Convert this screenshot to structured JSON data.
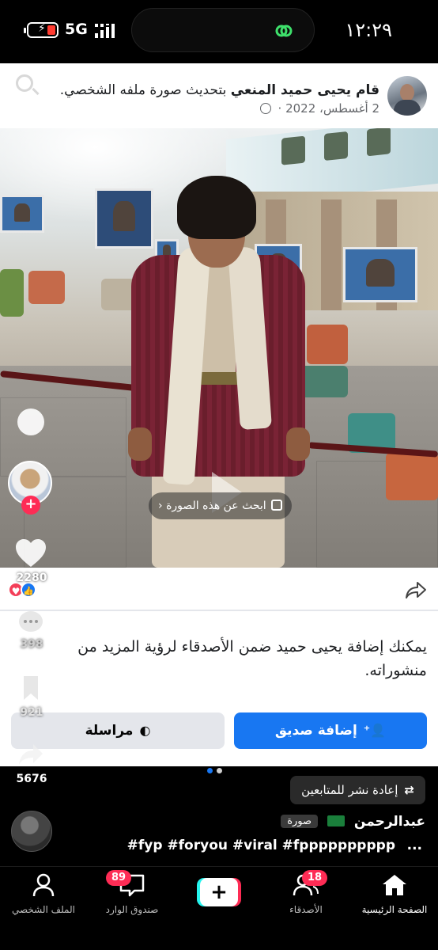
{
  "status_bar": {
    "time": "١٢:٢٩",
    "network": "5G"
  },
  "facebook_post": {
    "author_name": "قام يحيى حميد المنعي",
    "action_text": "بتحديث صورة ملفه الشخصي.",
    "date": "2 أغسطس، 2022",
    "separator": "·",
    "search_image_label": "ابحث عن هذه الصورة",
    "suggestion_text": "يمكنك إضافة يحيى حميد ضمن الأصدقاء لرؤية المزيد من منشوراته.",
    "add_friend_label": "إضافة صديق",
    "message_label": "مراسلة"
  },
  "tiktok": {
    "like_count": "2280",
    "comment_count": "398",
    "bookmark_count": "921",
    "share_count": "5676",
    "repost_label": "إعادة نشر للمتابعين",
    "author": "عبدالرحمن",
    "photo_tag": "صورة",
    "caption": "#fyp #foryou #viral #fpppppppppp",
    "caption_more": "...",
    "nav": {
      "home": "الصفحة الرئيسية",
      "friends": "الأصدقاء",
      "friends_badge": "18",
      "inbox": "صندوق الوارد",
      "inbox_badge": "89",
      "profile": "الملف الشخصي",
      "create": "+"
    }
  },
  "colors": {
    "fb_blue": "#1877f2",
    "tiktok_red": "#fe2c55",
    "tiktok_cyan": "#25f4ee"
  }
}
